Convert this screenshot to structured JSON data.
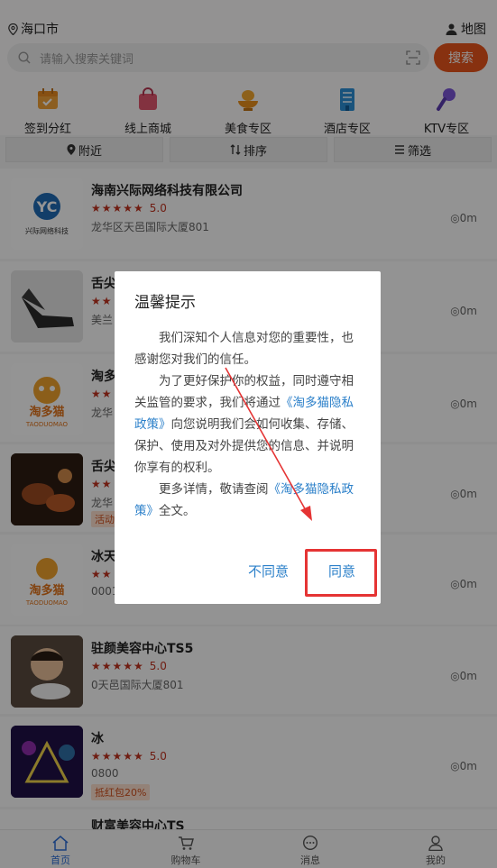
{
  "header": {
    "location": "海口市",
    "map_label": "地图",
    "search_placeholder": "请输入搜索关键词",
    "search_button": "搜索"
  },
  "categories": [
    {
      "label": "签到分红",
      "icon": "calendar-icon",
      "color": "#f2a33a"
    },
    {
      "label": "线上商城",
      "icon": "shopping-bag-icon",
      "color": "#e2566f"
    },
    {
      "label": "美食专区",
      "icon": "food-icon",
      "color": "#f0a22e"
    },
    {
      "label": "酒店专区",
      "icon": "hotel-icon",
      "color": "#2c8fd6"
    },
    {
      "label": "KTV专区",
      "icon": "microphone-icon",
      "color": "#7a55d8"
    }
  ],
  "filters": [
    {
      "label": "附近",
      "icon": "pin-icon"
    },
    {
      "label": "排序",
      "icon": "sort-icon"
    },
    {
      "label": "筛选",
      "icon": "menu-icon"
    }
  ],
  "listings": [
    {
      "title": "海南兴际网络科技有限公司",
      "stars": "★★★★★",
      "score": "5.0",
      "address": "龙华区天邑国际大厦801",
      "tag": "",
      "distance": "0m"
    },
    {
      "title": "舌尖",
      "stars": "★★",
      "score": "",
      "address": "美兰",
      "tag": "",
      "distance": "0m"
    },
    {
      "title": "淘多",
      "stars": "★★",
      "score": "",
      "address": "龙华",
      "tag": "",
      "distance": "0m"
    },
    {
      "title": "舌尖",
      "stars": "★★",
      "score": "",
      "address": "龙华",
      "tag": "活动",
      "distance": "0m"
    },
    {
      "title": "冰天",
      "stars": "★★",
      "score": "",
      "address": "0001",
      "tag": "",
      "distance": "0m"
    },
    {
      "title": "驻颜美容中心TS5",
      "stars": "★★★★★",
      "score": "5.0",
      "address": "0天邑国际大厦801",
      "tag": "",
      "distance": "0m"
    },
    {
      "title": "冰",
      "stars": "★★★★★",
      "score": "5.0",
      "address": "0800",
      "tag": "抵红包20%",
      "distance": "0m"
    },
    {
      "title": "财富美容中心TS",
      "stars": "",
      "score": "",
      "address": "",
      "tag": "",
      "distance": ""
    }
  ],
  "logo_texts": {
    "xingji": "兴际网络科技",
    "taoduomao": "淘多猫",
    "taoduomao_en": "TAODUOMAO"
  },
  "tabbar": [
    {
      "label": "首页",
      "icon": "home-icon",
      "active": true
    },
    {
      "label": "购物车",
      "icon": "cart-icon",
      "active": false
    },
    {
      "label": "消息",
      "icon": "message-icon",
      "active": false
    },
    {
      "label": "我的",
      "icon": "user-icon",
      "active": false
    }
  ],
  "dialog": {
    "title": "温馨提示",
    "p1": "我们深知个人信息对您的重要性，也感谢您对我们的信任。",
    "p2_before": "为了更好保护你的权益，同时遵守相关监管的要求，我们将通过",
    "p2_link": "《淘多猫隐私政策》",
    "p2_after": "向您说明我们会如何收集、存储、保护、使用及对外提供您的信息、并说明你享有的权利。",
    "p3_before": "更多详情，敬请查阅",
    "p3_link": "《淘多猫隐私政策》",
    "p3_after": "全文。",
    "disagree": "不同意",
    "agree": "同意"
  },
  "colors": {
    "accent": "#e8551d",
    "link": "#2a7fc9",
    "highlight": "#e53434",
    "tab_active": "#2e6fd8"
  }
}
